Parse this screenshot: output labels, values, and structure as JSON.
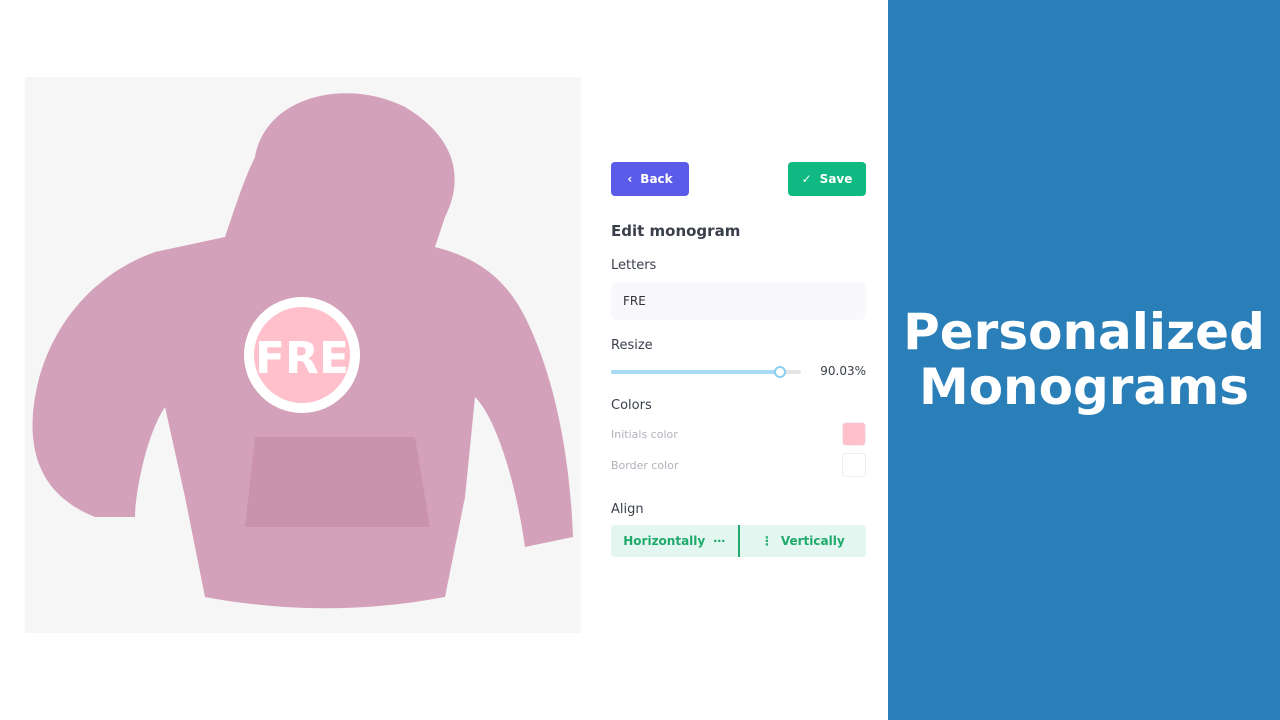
{
  "monogram": {
    "letters": "FRE"
  },
  "panel": {
    "back_label": "Back",
    "save_label": "Save",
    "title": "Edit monogram",
    "letters_label": "Letters",
    "letters_value": "FRE",
    "resize_label": "Resize",
    "resize_value": "90.03%",
    "resize_fraction": 0.9003,
    "colors_label": "Colors",
    "initials_color_label": "Initials color",
    "border_color_label": "Border color",
    "initials_color": "#ffc0cb",
    "border_color": "#ffffff",
    "align_label": "Align",
    "horizontally_label": "Horizontally",
    "vertically_label": "Vertically"
  },
  "banner": {
    "line1": "Personalized",
    "line2": "Monograms",
    "color": "#2a7fb8"
  }
}
